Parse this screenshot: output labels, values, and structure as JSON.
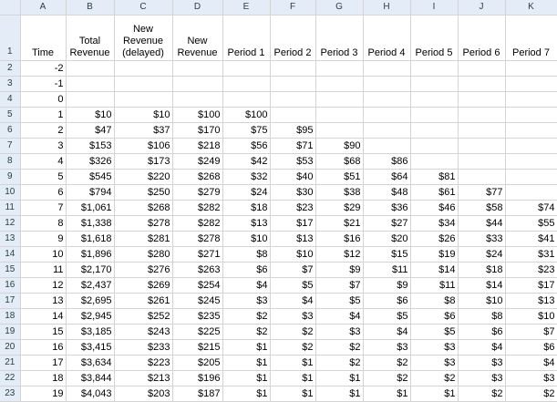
{
  "columns": [
    "A",
    "B",
    "C",
    "D",
    "E",
    "F",
    "G",
    "H",
    "I",
    "J",
    "K"
  ],
  "header": {
    "row_number": "1",
    "cells": [
      "Time",
      "Total Revenue",
      "New Revenue (delayed)",
      "New Revenue",
      "Period 1",
      "Period 2",
      "Period 3",
      "Period 4",
      "Period 5",
      "Period 6",
      "Period 7"
    ]
  },
  "rows": [
    {
      "n": "2",
      "cells": [
        "-2",
        "",
        "",
        "",
        "",
        "",
        "",
        "",
        "",
        "",
        ""
      ]
    },
    {
      "n": "3",
      "cells": [
        "-1",
        "",
        "",
        "",
        "",
        "",
        "",
        "",
        "",
        "",
        ""
      ]
    },
    {
      "n": "4",
      "cells": [
        "0",
        "",
        "",
        "",
        "",
        "",
        "",
        "",
        "",
        "",
        ""
      ]
    },
    {
      "n": "5",
      "cells": [
        "1",
        "$10",
        "$10",
        "$100",
        "$100",
        "",
        "",
        "",
        "",
        "",
        ""
      ]
    },
    {
      "n": "6",
      "cells": [
        "2",
        "$47",
        "$37",
        "$170",
        "$75",
        "$95",
        "",
        "",
        "",
        "",
        ""
      ]
    },
    {
      "n": "7",
      "cells": [
        "3",
        "$153",
        "$106",
        "$218",
        "$56",
        "$71",
        "$90",
        "",
        "",
        "",
        ""
      ]
    },
    {
      "n": "8",
      "cells": [
        "4",
        "$326",
        "$173",
        "$249",
        "$42",
        "$53",
        "$68",
        "$86",
        "",
        "",
        ""
      ]
    },
    {
      "n": "9",
      "cells": [
        "5",
        "$545",
        "$220",
        "$268",
        "$32",
        "$40",
        "$51",
        "$64",
        "$81",
        "",
        ""
      ]
    },
    {
      "n": "10",
      "cells": [
        "6",
        "$794",
        "$250",
        "$279",
        "$24",
        "$30",
        "$38",
        "$48",
        "$61",
        "$77",
        ""
      ]
    },
    {
      "n": "11",
      "cells": [
        "7",
        "$1,061",
        "$268",
        "$282",
        "$18",
        "$23",
        "$29",
        "$36",
        "$46",
        "$58",
        "$74"
      ]
    },
    {
      "n": "12",
      "cells": [
        "8",
        "$1,338",
        "$278",
        "$282",
        "$13",
        "$17",
        "$21",
        "$27",
        "$34",
        "$44",
        "$55"
      ]
    },
    {
      "n": "13",
      "cells": [
        "9",
        "$1,618",
        "$281",
        "$278",
        "$10",
        "$13",
        "$16",
        "$20",
        "$26",
        "$33",
        "$41"
      ]
    },
    {
      "n": "14",
      "cells": [
        "10",
        "$1,896",
        "$280",
        "$271",
        "$8",
        "$10",
        "$12",
        "$15",
        "$19",
        "$24",
        "$31"
      ]
    },
    {
      "n": "15",
      "cells": [
        "11",
        "$2,170",
        "$276",
        "$263",
        "$6",
        "$7",
        "$9",
        "$11",
        "$14",
        "$18",
        "$23"
      ]
    },
    {
      "n": "16",
      "cells": [
        "12",
        "$2,437",
        "$269",
        "$254",
        "$4",
        "$5",
        "$7",
        "$9",
        "$11",
        "$14",
        "$17"
      ]
    },
    {
      "n": "17",
      "cells": [
        "13",
        "$2,695",
        "$261",
        "$245",
        "$3",
        "$4",
        "$5",
        "$6",
        "$8",
        "$10",
        "$13"
      ]
    },
    {
      "n": "18",
      "cells": [
        "14",
        "$2,945",
        "$252",
        "$235",
        "$2",
        "$3",
        "$4",
        "$5",
        "$6",
        "$8",
        "$10"
      ]
    },
    {
      "n": "19",
      "cells": [
        "15",
        "$3,185",
        "$243",
        "$225",
        "$2",
        "$2",
        "$3",
        "$4",
        "$5",
        "$6",
        "$7"
      ]
    },
    {
      "n": "20",
      "cells": [
        "16",
        "$3,415",
        "$233",
        "$215",
        "$1",
        "$2",
        "$2",
        "$3",
        "$3",
        "$4",
        "$6"
      ]
    },
    {
      "n": "21",
      "cells": [
        "17",
        "$3,634",
        "$223",
        "$205",
        "$1",
        "$1",
        "$2",
        "$2",
        "$3",
        "$3",
        "$4"
      ]
    },
    {
      "n": "22",
      "cells": [
        "18",
        "$3,844",
        "$213",
        "$196",
        "$1",
        "$1",
        "$1",
        "$2",
        "$2",
        "$3",
        "$3"
      ]
    },
    {
      "n": "23",
      "cells": [
        "19",
        "$4,043",
        "$203",
        "$187",
        "$1",
        "$1",
        "$1",
        "$1",
        "$1",
        "$2",
        "$2"
      ]
    }
  ]
}
